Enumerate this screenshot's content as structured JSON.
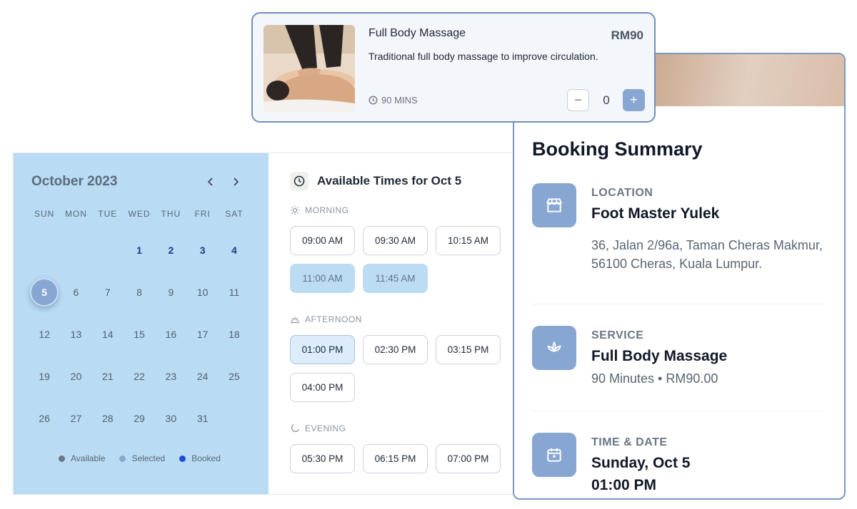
{
  "service": {
    "name": "Full Body Massage",
    "description": "Traditional full body massage to improve circulation.",
    "price": "RM90",
    "duration": "90 MINS",
    "quantity": "0",
    "minus_label": "−",
    "plus_label": "+"
  },
  "calendar": {
    "month": "October 2023",
    "weekdays": [
      "SUN",
      "MON",
      "TUE",
      "WED",
      "THU",
      "FRI",
      "SAT"
    ],
    "days": [
      {
        "label": "",
        "state": "empty"
      },
      {
        "label": "",
        "state": "empty"
      },
      {
        "label": "",
        "state": "empty"
      },
      {
        "label": "1",
        "state": "booked"
      },
      {
        "label": "2",
        "state": "booked"
      },
      {
        "label": "3",
        "state": "booked"
      },
      {
        "label": "4",
        "state": "booked"
      },
      {
        "label": "5",
        "state": "selected"
      },
      {
        "label": "6",
        "state": "available"
      },
      {
        "label": "7",
        "state": "available"
      },
      {
        "label": "8",
        "state": "available"
      },
      {
        "label": "9",
        "state": "available"
      },
      {
        "label": "10",
        "state": "available"
      },
      {
        "label": "11",
        "state": "available"
      },
      {
        "label": "12",
        "state": "available"
      },
      {
        "label": "13",
        "state": "available"
      },
      {
        "label": "14",
        "state": "available"
      },
      {
        "label": "15",
        "state": "available"
      },
      {
        "label": "16",
        "state": "available"
      },
      {
        "label": "17",
        "state": "available"
      },
      {
        "label": "18",
        "state": "available"
      },
      {
        "label": "19",
        "state": "available"
      },
      {
        "label": "20",
        "state": "available"
      },
      {
        "label": "21",
        "state": "available"
      },
      {
        "label": "22",
        "state": "available"
      },
      {
        "label": "23",
        "state": "available"
      },
      {
        "label": "24",
        "state": "available"
      },
      {
        "label": "25",
        "state": "available"
      },
      {
        "label": "26",
        "state": "available"
      },
      {
        "label": "27",
        "state": "available"
      },
      {
        "label": "28",
        "state": "available"
      },
      {
        "label": "29",
        "state": "available"
      },
      {
        "label": "30",
        "state": "available"
      },
      {
        "label": "31",
        "state": "available"
      }
    ],
    "legend": [
      {
        "label": "Available",
        "color": "#6b7785"
      },
      {
        "label": "Selected",
        "color": "#8aa8cf"
      },
      {
        "label": "Booked",
        "color": "#1d4ed8"
      }
    ]
  },
  "times": {
    "title": "Available Times for Oct 5",
    "periods": [
      {
        "label": "MORNING",
        "icon": "sun-icon",
        "slots": [
          {
            "label": "09:00 AM",
            "state": "available"
          },
          {
            "label": "09:30 AM",
            "state": "available"
          },
          {
            "label": "10:15 AM",
            "state": "available"
          },
          {
            "label": "11:00 AM",
            "state": "unavailable"
          },
          {
            "label": "11:45 AM",
            "state": "unavailable"
          }
        ]
      },
      {
        "label": "AFTERNOON",
        "icon": "sunset-icon",
        "slots": [
          {
            "label": "01:00 PM",
            "state": "chosen"
          },
          {
            "label": "02:30 PM",
            "state": "available"
          },
          {
            "label": "03:15 PM",
            "state": "available"
          },
          {
            "label": "04:00 PM",
            "state": "available"
          }
        ]
      },
      {
        "label": "EVENING",
        "icon": "moon-icon",
        "slots": [
          {
            "label": "05:30 PM",
            "state": "available"
          },
          {
            "label": "06:15 PM",
            "state": "available"
          },
          {
            "label": "07:00 PM",
            "state": "available"
          }
        ]
      }
    ]
  },
  "summary": {
    "title": "Booking Summary",
    "location": {
      "label": "LOCATION",
      "name": "Foot Master Yulek",
      "address_line1": "36, Jalan 2/96a, Taman Cheras Makmur,",
      "address_line2": "56100 Cheras, Kuala Lumpur."
    },
    "service": {
      "label": "SERVICE",
      "name": "Full Body Massage",
      "detail": "90 Minutes • RM90.00"
    },
    "time": {
      "label": "TIME & DATE",
      "date": "Sunday, Oct 5",
      "time": "01:00 PM"
    }
  },
  "colors": {
    "accent": "#87a6d2",
    "calendar_bg": "#b9dbf3",
    "card_border": "#6f8fbd"
  }
}
